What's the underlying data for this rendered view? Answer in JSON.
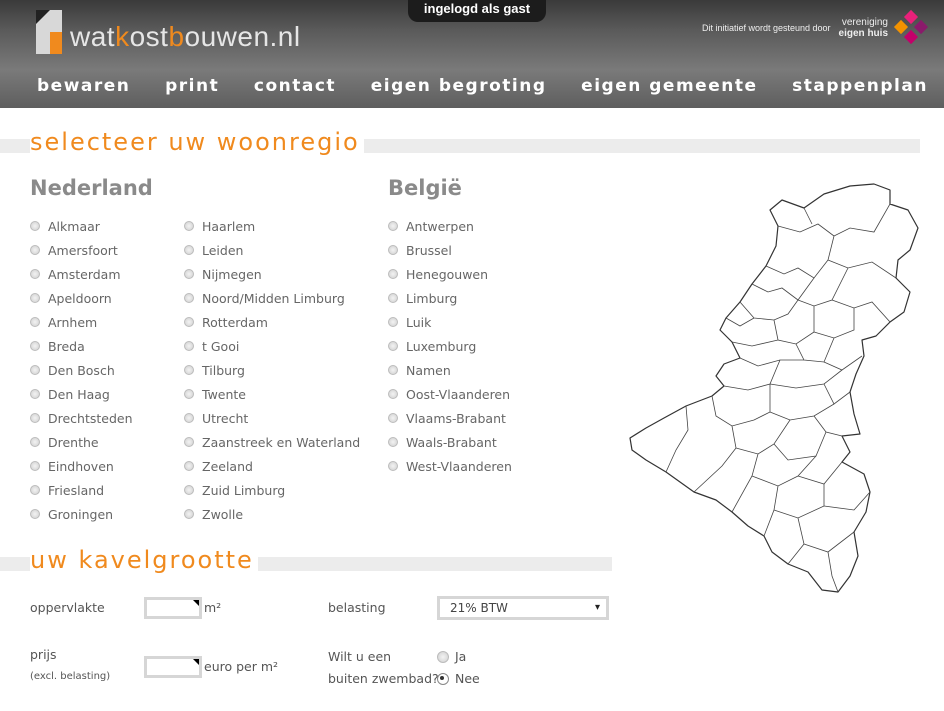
{
  "header": {
    "logo": {
      "part1": "wat",
      "k": "k",
      "part2": "ost",
      "b": "b",
      "part3": "ouwen.nl"
    },
    "login_status": "ingelogd als gast",
    "sponsor_text": "Dit initiatief wordt gesteund door",
    "sponsor_name_line1": "vereniging",
    "sponsor_name_line2": "eigen huis"
  },
  "nav": [
    "bewaren",
    "print",
    "contact",
    "eigen begroting",
    "eigen gemeente",
    "stappenplan"
  ],
  "region_section": {
    "title": "selecteer uw woonregio",
    "nederland": {
      "label": "Nederland",
      "col1": [
        "Alkmaar",
        "Amersfoort",
        "Amsterdam",
        "Apeldoorn",
        "Arnhem",
        "Breda",
        "Den Bosch",
        "Den Haag",
        "Drechtsteden",
        "Drenthe",
        "Eindhoven",
        "Friesland",
        "Groningen"
      ],
      "col2": [
        "Haarlem",
        "Leiden",
        "Nijmegen",
        "Noord/Midden Limburg",
        "Rotterdam",
        "t Gooi",
        "Tilburg",
        "Twente",
        "Utrecht",
        "Zaanstreek en Waterland",
        "Zeeland",
        "Zuid Limburg",
        "Zwolle"
      ]
    },
    "belgie": {
      "label": "België",
      "items": [
        "Antwerpen",
        "Brussel",
        "Henegouwen",
        "Limburg",
        "Luik",
        "Luxemburg",
        "Namen",
        "Oost-Vlaanderen",
        "Vlaams-Brabant",
        "Waals-Brabant",
        "West-Vlaanderen"
      ]
    }
  },
  "plot_section": {
    "title": "uw kavelgrootte",
    "oppervlakte_label": "oppervlakte",
    "oppervlakte_value": "",
    "oppervlakte_unit": "m²",
    "prijs_label": "prijs",
    "prijs_sub": "(excl. belasting)",
    "prijs_value": "",
    "prijs_unit": "euro per m²",
    "belasting_label": "belasting",
    "belasting_selected": "21% BTW",
    "zwembad_label_line1": "Wilt u een",
    "zwembad_label_line2": "buiten zwembad?",
    "zwembad_options": [
      "Ja",
      "Nee"
    ],
    "zwembad_selected": "Nee"
  },
  "colors": {
    "accent": "#f08a1e",
    "header_dark": "#3a3a3a",
    "text": "#666666"
  },
  "icons": {
    "select_caret": "▾"
  }
}
